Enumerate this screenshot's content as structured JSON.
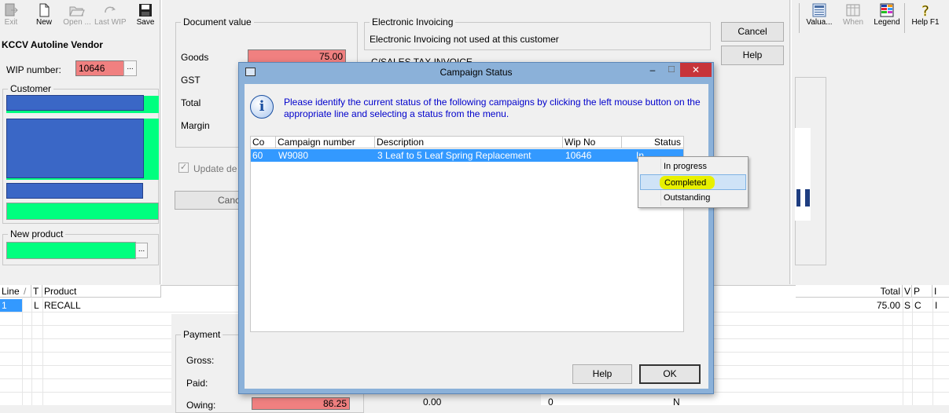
{
  "toolbar_left": [
    {
      "name": "exit-button",
      "label": "Exit",
      "icon": "exit-icon",
      "disabled": true
    },
    {
      "name": "new-button",
      "label": "New",
      "icon": "new-document-icon",
      "disabled": false
    },
    {
      "name": "open-button",
      "label": "Open ...",
      "icon": "open-folder-icon",
      "disabled": true
    },
    {
      "name": "last-wip-button",
      "label": "Last WIP",
      "icon": "redo-arrow-icon",
      "disabled": true
    },
    {
      "name": "save-button",
      "label": "Save",
      "icon": "save-disk-icon",
      "disabled": false
    }
  ],
  "toolbar_right": [
    {
      "name": "valuation-button",
      "label": "Valua...",
      "icon": "calculator-icon",
      "disabled": false
    },
    {
      "name": "when-button",
      "label": "When",
      "icon": "calendar-icon",
      "disabled": true
    },
    {
      "name": "legend-button",
      "label": "Legend",
      "icon": "legend-icon",
      "disabled": false
    },
    {
      "name": "help-f1-button",
      "label": "Help F1",
      "icon": "question-icon",
      "disabled": false
    }
  ],
  "vendor_title": "KCCV Autoline Vendor",
  "wip": {
    "label": "WIP number:",
    "value": "10646",
    "browse": "..."
  },
  "customer_legend": "Customer",
  "new_product": {
    "legend": "New product",
    "browse": "..."
  },
  "document_value": {
    "legend": "Document value",
    "goods_label": "Goods",
    "goods_value": "75.00",
    "gst_label": "GST",
    "total_label": "Total",
    "margin_label": "Margin"
  },
  "update_checkbox_label": "Update de",
  "cancel_partial": "Canc",
  "electronic_invoicing": {
    "legend": "Electronic Invoicing",
    "text": "Electronic Invoicing not used at this customer"
  },
  "partial_text": "C/SALES TAX INVOICE",
  "right_buttons": {
    "cancel": "Cancel",
    "help": "Help"
  },
  "payment": {
    "legend": "Payment",
    "gross": "Gross:",
    "paid": "Paid:",
    "owing": "Owing:",
    "owing_value": "86.25",
    "col_a": "0.00",
    "col_b": "0",
    "col_c": "N"
  },
  "grid": {
    "headers_left": [
      "Line",
      "/",
      "T",
      "Product"
    ],
    "headers_right": [
      "Total",
      "V",
      "P",
      "I"
    ],
    "row": {
      "line": "1",
      "t": "L",
      "product": "RECALL",
      "total": "75.00",
      "v": "S",
      "p": "C",
      "i": "I"
    }
  },
  "dialog": {
    "title": "Campaign Status",
    "message": "Please identify the current status of the following campaigns by clicking the left mouse button on the appropriate line and selecting a status from the menu.",
    "columns": [
      "Co",
      "Campaign number",
      "Description",
      "Wip No",
      "Status"
    ],
    "row": {
      "co": "60",
      "campaign": "W9080",
      "description": "3 Leaf to 5 Leaf  Spring Replacement",
      "wip": "10646",
      "status": "In progress"
    },
    "help": "Help",
    "ok": "OK"
  },
  "context_menu": [
    "In progress",
    "Completed",
    "Outstanding"
  ],
  "colors": {
    "dialog_frame": "#8bb1d9",
    "close": "#c7343a",
    "selection": "#3399ff",
    "highlight": "#e8f000"
  }
}
